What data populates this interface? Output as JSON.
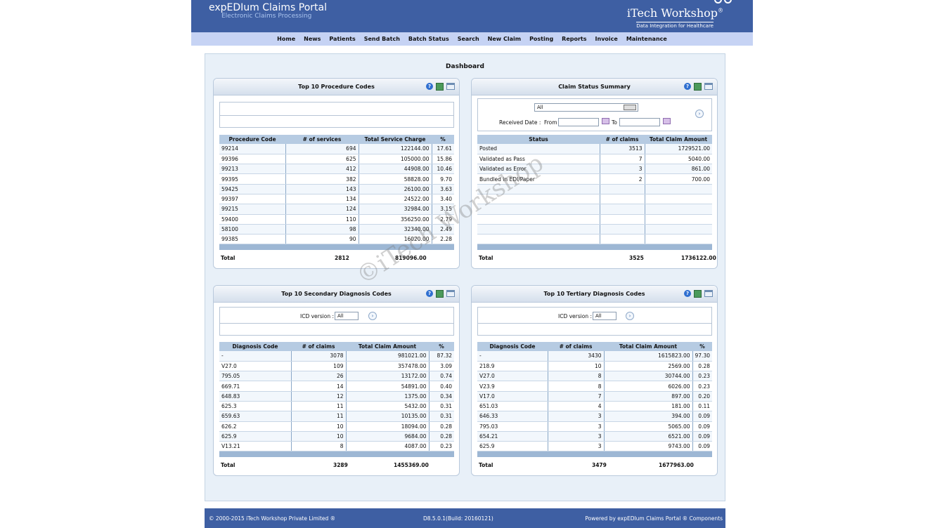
{
  "header": {
    "title": "expEDIum Claims Portal",
    "subtitle": "Electronic Claims Processing",
    "brand": "iTech Workshop",
    "brand_mark": "®",
    "brand_tagline": "Data Integration for Healthcare"
  },
  "nav": [
    "Home",
    "News",
    "Patients",
    "Send Batch",
    "Batch Status",
    "Search",
    "New Claim",
    "Posting",
    "Reports",
    "Invoice",
    "Maintenance"
  ],
  "dashboard_title": "Dashboard",
  "watermark": "©iTech Workshop",
  "procedure_panel": {
    "title": "Top 10 Procedure Codes",
    "headers": [
      "Procedure Code",
      "# of services",
      "Total Service Charge",
      "%"
    ],
    "rows": [
      [
        "99214",
        "694",
        "122144.00",
        "17.61"
      ],
      [
        "99396",
        "625",
        "105000.00",
        "15.86"
      ],
      [
        "99213",
        "412",
        "44908.00",
        "10.46"
      ],
      [
        "99395",
        "382",
        "58828.00",
        "9.70"
      ],
      [
        "59425",
        "143",
        "26100.00",
        "3.63"
      ],
      [
        "99397",
        "134",
        "24522.00",
        "3.40"
      ],
      [
        "99215",
        "124",
        "32984.00",
        "3.15"
      ],
      [
        "59400",
        "110",
        "356250.00",
        "2.79"
      ],
      [
        "58100",
        "98",
        "32340.00",
        "2.49"
      ],
      [
        "99385",
        "90",
        "16020.00",
        "2.28"
      ]
    ],
    "total": {
      "label": "Total",
      "count": "2812",
      "amount": "819096.00"
    }
  },
  "status_panel": {
    "title": "Claim Status Summary",
    "select_value": "All",
    "received_label": "Received Date :",
    "from_label": "From",
    "to_label": "To",
    "headers": [
      "Status",
      "# of claims",
      "Total Claim Amount"
    ],
    "rows": [
      [
        "Posted",
        "3513",
        "1729521.00"
      ],
      [
        "Validated as Pass",
        "7",
        "5040.00"
      ],
      [
        "Validated as Error",
        "3",
        "861.00"
      ],
      [
        "Bundled in EDI/Paper",
        "2",
        "700.00"
      ]
    ],
    "total": {
      "label": "Total",
      "count": "3525",
      "amount": "1736122.00"
    }
  },
  "secondary_panel": {
    "title": "Top 10 Secondary Diagnosis Codes",
    "icd_label": "ICD version :",
    "icd_value": "All",
    "headers": [
      "Diagnosis Code",
      "# of claims",
      "Total Claim Amount",
      "%"
    ],
    "rows": [
      [
        "-",
        "3078",
        "981021.00",
        "87.32"
      ],
      [
        "V27.0",
        "109",
        "357478.00",
        "3.09"
      ],
      [
        "795.05",
        "26",
        "13172.00",
        "0.74"
      ],
      [
        "669.71",
        "14",
        "54891.00",
        "0.40"
      ],
      [
        "648.83",
        "12",
        "1375.00",
        "0.34"
      ],
      [
        "625.3",
        "11",
        "5432.00",
        "0.31"
      ],
      [
        "659.63",
        "11",
        "10135.00",
        "0.31"
      ],
      [
        "626.2",
        "10",
        "18094.00",
        "0.28"
      ],
      [
        "625.9",
        "10",
        "9684.00",
        "0.28"
      ],
      [
        "V13.21",
        "8",
        "4087.00",
        "0.23"
      ]
    ],
    "total": {
      "label": "Total",
      "count": "3289",
      "amount": "1455369.00"
    }
  },
  "tertiary_panel": {
    "title": "Top 10 Tertiary Diagnosis Codes",
    "icd_label": "ICD version :",
    "icd_value": "All",
    "headers": [
      "Diagnosis Code",
      "# of claims",
      "Total Claim Amount",
      "%"
    ],
    "rows": [
      [
        "-",
        "3430",
        "1615823.00",
        "97.30"
      ],
      [
        "218.9",
        "10",
        "2569.00",
        "0.28"
      ],
      [
        "V27.0",
        "8",
        "30744.00",
        "0.23"
      ],
      [
        "V23.9",
        "8",
        "6026.00",
        "0.23"
      ],
      [
        "V17.0",
        "7",
        "897.00",
        "0.20"
      ],
      [
        "651.03",
        "4",
        "181.00",
        "0.11"
      ],
      [
        "646.33",
        "3",
        "394.00",
        "0.09"
      ],
      [
        "795.03",
        "3",
        "5065.00",
        "0.09"
      ],
      [
        "654.21",
        "3",
        "6521.00",
        "0.09"
      ],
      [
        "625.9",
        "3",
        "9743.00",
        "0.09"
      ]
    ],
    "total": {
      "label": "Total",
      "count": "3479",
      "amount": "1677963.00"
    }
  },
  "footer": {
    "copyright": "© 2000-2015 iTech Workshop Private Limited ®",
    "version": "D8.5.0.1(Build: 20160121)",
    "powered": "Powered by expEDIum Claims Portal ® Components"
  },
  "icons": {
    "help": "help-icon",
    "export": "excel-export-icon",
    "window": "window-icon",
    "go": "go-arrow-icon",
    "calendar": "calendar-icon"
  },
  "colors": {
    "header": "#3e5fa3",
    "nav": "#c6d3f4",
    "table_header": "#b6cbe2"
  }
}
